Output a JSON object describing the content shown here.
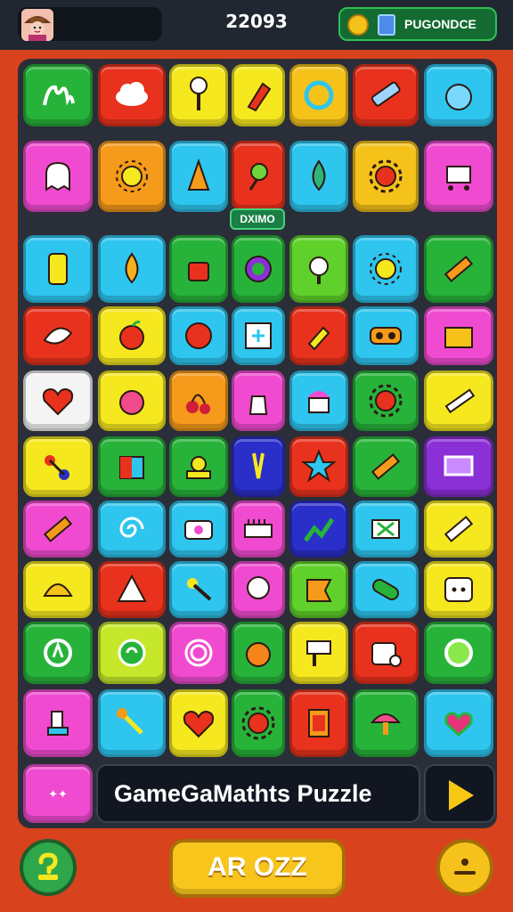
{
  "header": {
    "score": "22093",
    "currency_label": "PUGONDCE",
    "avatar_icon": "player-avatar",
    "coin_icon": "coin-icon",
    "gem_icon": "gem-icon"
  },
  "board": {
    "tag_label": "DXIMO",
    "tiles": [
      {
        "color": "#27b33a",
        "icon": "hand-scribble"
      },
      {
        "color": "#e8321d",
        "icon": "cloud"
      },
      {
        "color": "#f6e81f",
        "icon": "key"
      },
      {
        "color": "#f6e81f",
        "icon": "crayon"
      },
      {
        "color": "#f5c21a",
        "icon": "ring"
      },
      {
        "color": "#e8321d",
        "icon": "ruler"
      },
      {
        "color": "#2ec5ef",
        "icon": "bubble"
      },
      {
        "color": "#f04bd0",
        "icon": "ghost"
      },
      {
        "color": "#f59a1a",
        "icon": "sun"
      },
      {
        "color": "#2ec5ef",
        "icon": "cone"
      },
      {
        "color": "#e8321d",
        "icon": "sprout"
      },
      {
        "color": "#2ec5ef",
        "icon": "drop"
      },
      {
        "color": "#f5c21a",
        "icon": "gear"
      },
      {
        "color": "#f04bd0",
        "icon": "cart"
      },
      {
        "color": "#2ec5ef",
        "icon": "phone"
      },
      {
        "color": "#2ec5ef",
        "icon": "drop-gold"
      },
      {
        "color": "#27b33a",
        "icon": "pot"
      },
      {
        "color": "#27b33a",
        "icon": "target"
      },
      {
        "color": "#5fd12a",
        "icon": "face"
      },
      {
        "color": "#2ec5ef",
        "icon": "sun"
      },
      {
        "color": "#27b33a",
        "icon": "pencil"
      },
      {
        "color": "#e8321d",
        "icon": "leaf"
      },
      {
        "color": "#f6e81f",
        "icon": "apple"
      },
      {
        "color": "#2ec5ef",
        "icon": "ball"
      },
      {
        "color": "#2ec5ef",
        "icon": "frame"
      },
      {
        "color": "#e8321d",
        "icon": "fries"
      },
      {
        "color": "#2ec5ef",
        "icon": "binocular"
      },
      {
        "color": "#f04bd0",
        "icon": "box"
      },
      {
        "color": "#f4f4f4",
        "icon": "heart"
      },
      {
        "color": "#f6e81f",
        "icon": "apple-pink"
      },
      {
        "color": "#f59a1a",
        "icon": "cherry"
      },
      {
        "color": "#f04bd0",
        "icon": "bag"
      },
      {
        "color": "#2ec5ef",
        "icon": "cupcake"
      },
      {
        "color": "#27b33a",
        "icon": "gear"
      },
      {
        "color": "#f6e81f",
        "icon": "brush"
      },
      {
        "color": "#f6e81f",
        "icon": "flower"
      },
      {
        "color": "#27b33a",
        "icon": "cube"
      },
      {
        "color": "#27b33a",
        "icon": "bell"
      },
      {
        "color": "#2a2fc9",
        "icon": "tweezers"
      },
      {
        "color": "#e8321d",
        "icon": "star"
      },
      {
        "color": "#27b33a",
        "icon": "pencil"
      },
      {
        "color": "#8b2fd6",
        "icon": "screen"
      },
      {
        "color": "#f04bd0",
        "icon": "pencil"
      },
      {
        "color": "#2ec5ef",
        "icon": "swirl"
      },
      {
        "color": "#2ec5ef",
        "icon": "camera"
      },
      {
        "color": "#f04bd0",
        "icon": "comb"
      },
      {
        "color": "#2a2fc9",
        "icon": "chart"
      },
      {
        "color": "#2ec5ef",
        "icon": "ticket"
      },
      {
        "color": "#f6e81f",
        "icon": "pencil-white"
      },
      {
        "color": "#f6e81f",
        "icon": "shell"
      },
      {
        "color": "#e8321d",
        "icon": "onigiri"
      },
      {
        "color": "#2ec5ef",
        "icon": "wand"
      },
      {
        "color": "#f04bd0",
        "icon": "bubble-white"
      },
      {
        "color": "#5fd12a",
        "icon": "flag"
      },
      {
        "color": "#2ec5ef",
        "icon": "capsule"
      },
      {
        "color": "#f6e81f",
        "icon": "dice"
      },
      {
        "color": "#27b33a",
        "icon": "recycle"
      },
      {
        "color": "#c7e82a",
        "icon": "spiral"
      },
      {
        "color": "#f04bd0",
        "icon": "maze"
      },
      {
        "color": "#27b33a",
        "icon": "orange"
      },
      {
        "color": "#f6e81f",
        "icon": "roller"
      },
      {
        "color": "#e8321d",
        "icon": "radio"
      },
      {
        "color": "#27b33a",
        "icon": "lime"
      },
      {
        "color": "#f04bd0",
        "icon": "stand"
      },
      {
        "color": "#2ec5ef",
        "icon": "spark-wand"
      },
      {
        "color": "#f6e81f",
        "icon": "heart"
      },
      {
        "color": "#27b33a",
        "icon": "gear"
      },
      {
        "color": "#e8321d",
        "icon": "book"
      },
      {
        "color": "#27b33a",
        "icon": "mushroom"
      },
      {
        "color": "#2ec5ef",
        "icon": "heart-leaf"
      }
    ],
    "footer_tile": {
      "color": "#f04bd0",
      "icon": "sparkle-text"
    }
  },
  "title_panel": {
    "text": "GameGaMathts Puzzle",
    "play_icon": "play-triangle-icon"
  },
  "bottom": {
    "help_icon": "question-icon",
    "action_label": "AR OZZ",
    "menu_icon": "menu-icon"
  }
}
